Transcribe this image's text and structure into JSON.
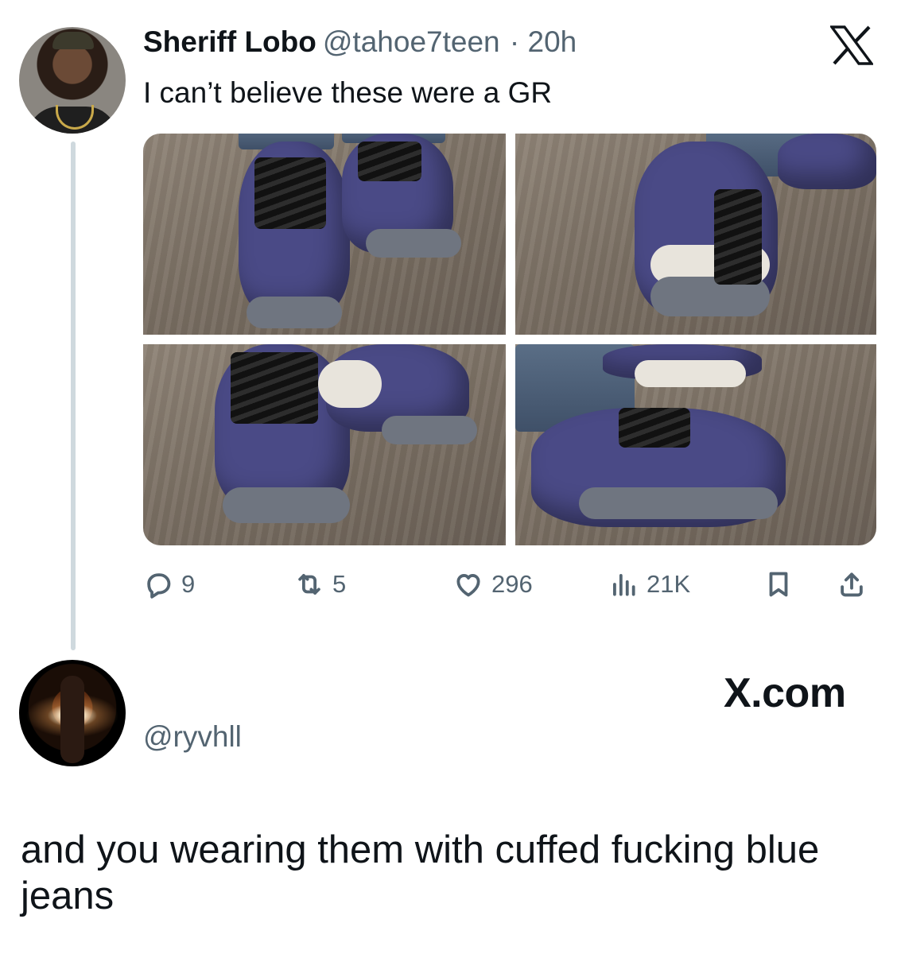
{
  "tweet": {
    "author_name": "Sheriff Lobo",
    "handle": "@tahoe7teen",
    "time": "· 20h",
    "text": "I can’t believe these were a GR",
    "platform_icon": "x-logo-icon",
    "images": [
      {
        "alt": "photo of purple suede sneakers on wood floor"
      },
      {
        "alt": "photo of purple suede sneakers on wood floor"
      },
      {
        "alt": "photo of purple suede sneakers on wood floor"
      },
      {
        "alt": "photo of purple suede sneakers on wood floor"
      }
    ],
    "stats": {
      "replies": "9",
      "reposts": "5",
      "likes": "296",
      "views": "21K"
    }
  },
  "reply": {
    "handle": "@ryvhll",
    "brand": "X.com",
    "text": "and you wearing them with cuffed fucking blue jeans"
  },
  "colors": {
    "text_primary": "#0f1419",
    "text_secondary": "#536471",
    "thread_line": "#cfd9de"
  }
}
